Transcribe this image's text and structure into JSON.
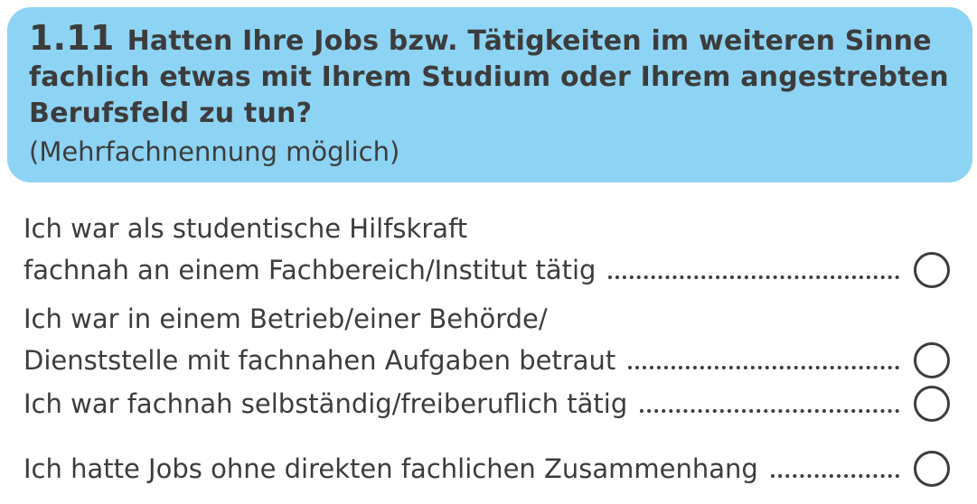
{
  "question": {
    "number": "1.11",
    "title": "Hatten Ihre Jobs bzw. Tätigkeiten im weiteren Sinne fachlich etwas mit Ihrem Studium oder Ihrem angestrebten Berufsfeld zu tun?",
    "note": "(Mehrfachnennung möglich)"
  },
  "options": [
    {
      "line1": "Ich war als studentische Hilfskraft",
      "line2": "fachnah an einem Fachbereich/Institut tätig"
    },
    {
      "line1": "Ich war in einem Betrieb/einer Behörde/",
      "line2": "Dienststelle mit fachnahen Aufgaben betraut"
    },
    {
      "line2": "Ich war fachnah selbständig/freiberuflich tätig"
    },
    {
      "line2": "Ich hatte Jobs ohne direkten fachlichen Zusammenhang"
    }
  ],
  "colors": {
    "header_background": "#8dd3f3",
    "text": "#3c3c3c"
  }
}
